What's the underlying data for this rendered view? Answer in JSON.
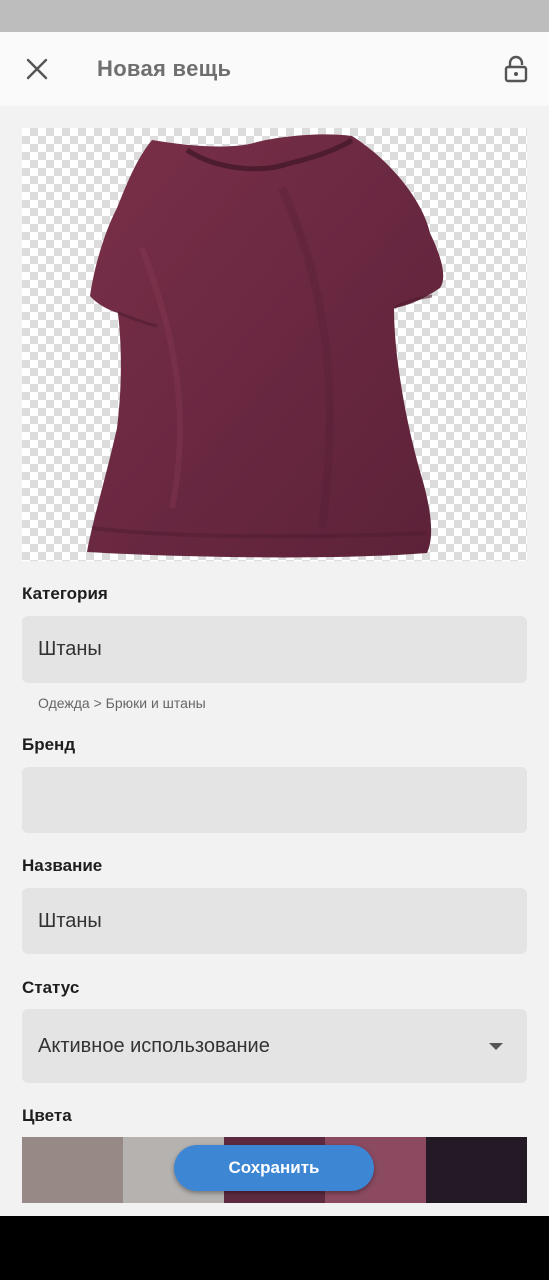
{
  "header": {
    "title": "Новая вещь",
    "close_icon": "close-icon",
    "lock_icon": "lock-icon"
  },
  "photo": {
    "subject": "item-photo",
    "shirt_color": "#6e2a43"
  },
  "form": {
    "category": {
      "label": "Категория",
      "value": "Штаны",
      "helper": "Одежда > Брюки и штаны"
    },
    "brand": {
      "label": "Бренд",
      "value": ""
    },
    "name": {
      "label": "Название",
      "value": "Штаны"
    },
    "status": {
      "label": "Статус",
      "value": "Активное использование"
    },
    "colors": {
      "label": "Цвета",
      "swatches": [
        "#978a86",
        "#b5b2b0",
        "#5e2a3f",
        "#8b4a60",
        "#231a26"
      ]
    }
  },
  "actions": {
    "save_label": "Сохранить"
  },
  "theme": {
    "accent": "#3d86d3"
  }
}
